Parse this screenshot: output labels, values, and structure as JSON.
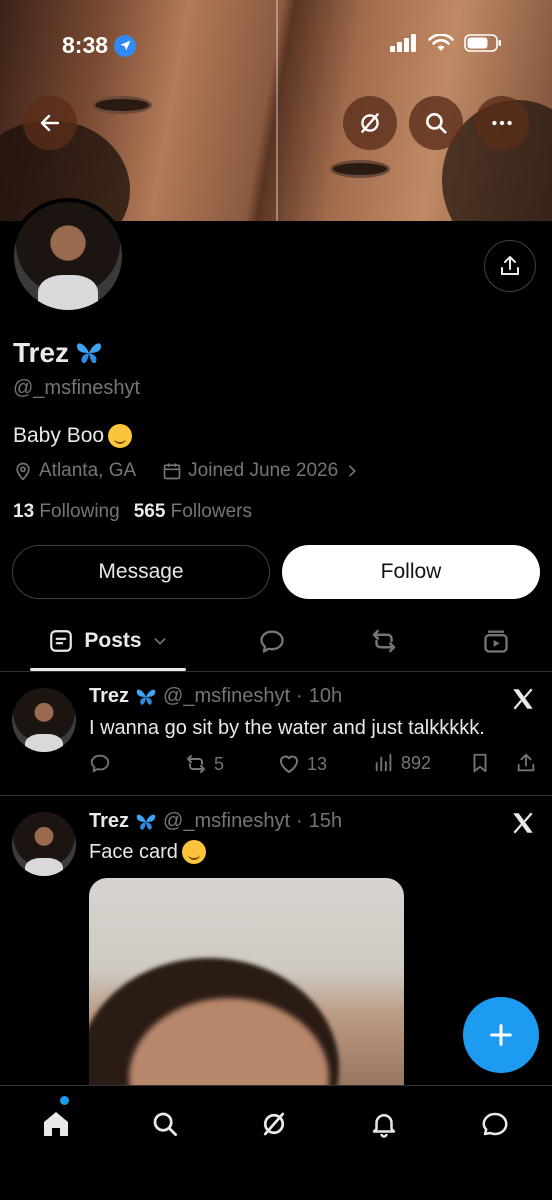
{
  "status_bar": {
    "time": "8:38"
  },
  "profile": {
    "display_name": "Trez",
    "handle": "@_msfineshyt",
    "bio": "Baby Boo",
    "location": "Atlanta, GA",
    "joined": "Joined June 2026",
    "following_count": "13",
    "following_label": "Following",
    "followers_count": "565",
    "followers_label": "Followers"
  },
  "buttons": {
    "message": "Message",
    "follow": "Follow"
  },
  "tabs": {
    "posts": "Posts"
  },
  "posts": [
    {
      "name": "Trez",
      "handle": "@_msfineshyt",
      "time": "10h",
      "text": "I wanna go sit by the water and just talkkkkk.",
      "reposts": "5",
      "likes": "13",
      "views": "892"
    },
    {
      "name": "Trez",
      "handle": "@_msfineshyt",
      "time": "15h",
      "text": "Face card"
    }
  ],
  "colors": {
    "accent": "#1d9bf0",
    "background": "#000000",
    "muted": "#71767b"
  },
  "icons": [
    "back-arrow-icon",
    "grok-icon",
    "search-icon",
    "more-icon",
    "share-icon",
    "butterfly-icon",
    "location-icon",
    "calendar-icon",
    "chevron-right-icon",
    "posts-icon",
    "chevron-down-icon",
    "replies-icon",
    "reposts-icon",
    "media-icon",
    "x-logo-icon",
    "reply-icon",
    "repost-icon",
    "like-icon",
    "views-icon",
    "bookmark-icon",
    "upload-icon",
    "compose-plus-icon",
    "home-icon",
    "notifications-icon",
    "messages-icon"
  ]
}
